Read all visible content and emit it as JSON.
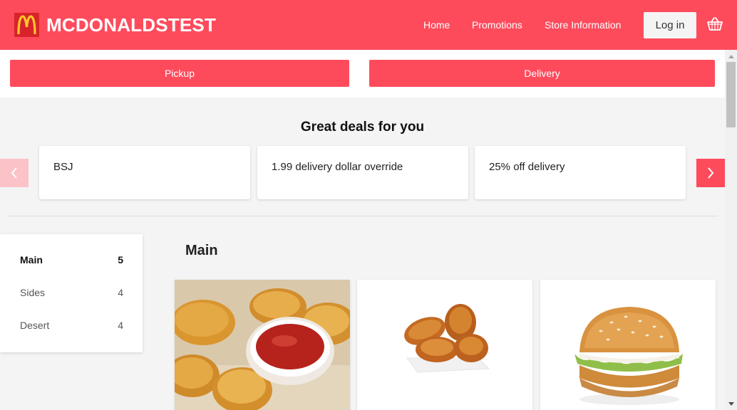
{
  "header": {
    "brand": "MCDONALDSTEST",
    "nav": [
      "Home",
      "Promotions",
      "Store Information"
    ],
    "login_label": "Log in",
    "brand_color": "#fe4b5c",
    "cart_icon": "basket-icon",
    "logo_icon": "golden-arches-logo"
  },
  "order_modes": [
    "Pickup",
    "Delivery"
  ],
  "deals": {
    "title": "Great deals for you",
    "items": [
      "BSJ",
      "1.99 delivery dollar override",
      "25% off delivery"
    ]
  },
  "categories": [
    {
      "name": "Main",
      "count": "5",
      "active": true
    },
    {
      "name": "Sides",
      "count": "4",
      "active": false
    },
    {
      "name": "Desert",
      "count": "4",
      "active": false
    }
  ],
  "section": {
    "title": "Main",
    "products": [
      {
        "image": "chicken-nuggets-with-ketchup"
      },
      {
        "image": "fried-chicken-pieces"
      },
      {
        "image": "chicken-burger"
      }
    ]
  }
}
